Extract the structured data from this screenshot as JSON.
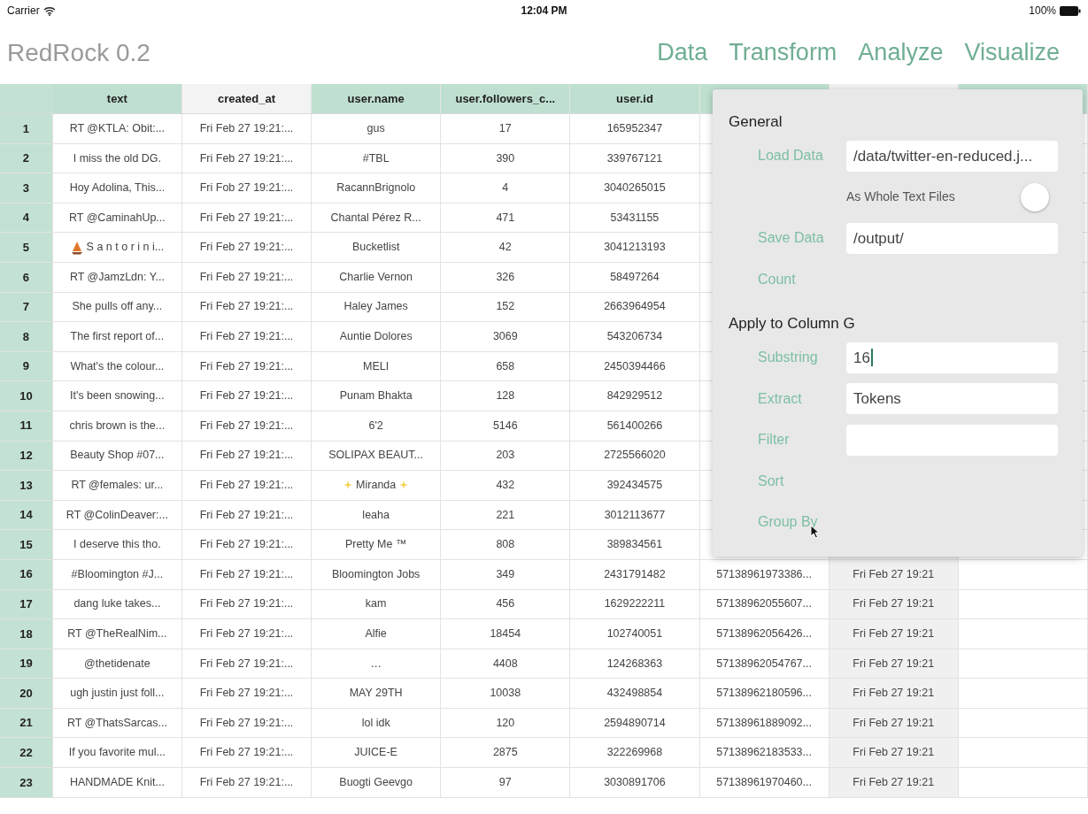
{
  "status_bar": {
    "carrier": "Carrier",
    "time": "12:04 PM",
    "battery": "100%"
  },
  "app_title": "RedRock 0.2",
  "nav": [
    {
      "label": "Data"
    },
    {
      "label": "Transform"
    },
    {
      "label": "Analyze"
    },
    {
      "label": "Visualize"
    }
  ],
  "table": {
    "columns": [
      {
        "label": "text",
        "selected": false
      },
      {
        "label": "created_at",
        "selected": true
      },
      {
        "label": "user.name",
        "selected": false
      },
      {
        "label": "user.followers_c...",
        "selected": false
      },
      {
        "label": "user.id",
        "selected": false
      },
      {
        "selected": false
      },
      {
        "selected": true,
        "shaded": true
      },
      {
        "selected": false
      }
    ],
    "rows": [
      {
        "index": "1",
        "cells": [
          "RT @KTLA: Obit:...",
          "Fri Feb 27 19:21:...",
          "gus",
          "17",
          "165952347"
        ]
      },
      {
        "index": "2",
        "cells": [
          "I miss the old DG.",
          "Fri Feb 27 19:21:...",
          "#TBL",
          "390",
          "339767121"
        ]
      },
      {
        "index": "3",
        "cells": [
          "Hoy Adolina, This...",
          "Fri Fob 27 19:21:...",
          "RacannBrignolo",
          "4",
          "3040265015"
        ]
      },
      {
        "index": "4",
        "cells": [
          "RT @CaminahUp...",
          "Fri Feb 27 19:21:...",
          "Chantal Pérez R...",
          "471",
          "53431155"
        ]
      },
      {
        "index": "5",
        "boat_icon": true,
        "cells": [
          "S a n t o r i n i...",
          "Fri Feb 27 19:21:...",
          "Bucketlist",
          "42",
          "3041213193"
        ]
      },
      {
        "index": "6",
        "cells": [
          "RT @JamzLdn: Y...",
          "Fri Feb 27 19:21:...",
          "Charlie Vernon",
          "326",
          "58497264"
        ]
      },
      {
        "index": "7",
        "cells": [
          "She pulls off any...",
          "Fri Feb 27 19:21:...",
          "Haley James",
          "152",
          "2663964954"
        ]
      },
      {
        "index": "8",
        "cells": [
          "The first report of...",
          "Fri Feb 27 19:21:...",
          "Auntie Dolores",
          "3069",
          "543206734"
        ]
      },
      {
        "index": "9",
        "cells": [
          "What's the colour...",
          "Fri Feb 27 19:21:...",
          "MELI",
          "658",
          "2450394466"
        ]
      },
      {
        "index": "10",
        "cells": [
          "It's been snowing...",
          "Fri Feb 27 19:21:...",
          "Punam Bhakta",
          "128",
          "842929512"
        ]
      },
      {
        "index": "11",
        "cells": [
          "chris brown is the...",
          "Fri Feb 27 19:21:...",
          "6'2",
          "5146",
          "561400266"
        ]
      },
      {
        "index": "12",
        "cells": [
          "Beauty Shop #07...",
          "Fri Feb 27 19:21:...",
          "SOLIPAX BEAUT...",
          "203",
          "2725566020"
        ]
      },
      {
        "index": "13",
        "name_sparkles": true,
        "cells": [
          "RT @females: ur...",
          "Fri Feb 27 19:21:...",
          "Miranda",
          "432",
          "392434575"
        ]
      },
      {
        "index": "14",
        "cells": [
          "RT @ColinDeaver:...",
          "Fri Feb 27 19:21:...",
          "leaha",
          "221",
          "3012113677"
        ]
      },
      {
        "index": "15",
        "cells": [
          "I deserve this tho.",
          "Fri Feb 27 19:21:...",
          "Pretty Me ™",
          "808",
          "389834561"
        ]
      },
      {
        "index": "16",
        "cells": [
          "#Bloomington #J...",
          "Fri Feb 27 19:21:...",
          "Bloomington Jobs",
          "349",
          "2431791482",
          "57138961973386...",
          "Fri Feb 27 19:21"
        ]
      },
      {
        "index": "17",
        "cells": [
          "dang luke takes...",
          "Fri Feb 27 19:21:...",
          "kam",
          "456",
          "1629222211",
          "57138962055607...",
          "Fri Feb 27 19:21"
        ]
      },
      {
        "index": "18",
        "cells": [
          "RT @TheRealNim...",
          "Fri Feb 27 19:21:...",
          "Alfie",
          "18454",
          "102740051",
          "57138962056426...",
          "Fri Feb 27 19:21"
        ]
      },
      {
        "index": "19",
        "cells": [
          "@thetidenate",
          "Fri Feb 27 19:21:...",
          "…",
          "4408",
          "124268363",
          "57138962054767...",
          "Fri Feb 27 19:21"
        ]
      },
      {
        "index": "20",
        "cells": [
          "ugh justin just foll...",
          "Fri Feb 27 19:21:...",
          "MAY 29TH",
          "10038",
          "432498854",
          "57138962180596...",
          "Fri Feb 27 19:21"
        ]
      },
      {
        "index": "21",
        "cells": [
          "RT @ThatsSarcas...",
          "Fri Feb 27 19:21:...",
          "lol idk",
          "120",
          "2594890714",
          "57138961889092...",
          "Fri Feb 27 19:21"
        ]
      },
      {
        "index": "22",
        "cells": [
          "If you favorite mul...",
          "Fri Feb 27 19:21:...",
          "JUICE-E",
          "2875",
          "322269968",
          "57138962183533...",
          "Fri Feb 27 19:21"
        ]
      },
      {
        "index": "23",
        "cells": [
          "HANDMADE Knit...",
          "Fri Feb 27 19:21:...",
          "Buogti Geevgo",
          "97",
          "3030891706",
          "57138961970460...",
          "Fri Feb 27 19:21"
        ]
      }
    ]
  },
  "panel": {
    "sections": [
      {
        "heading": "General",
        "items": [
          {
            "kind": "field",
            "label": "Load Data",
            "value": "/data/twitter-en-reduced.j..."
          },
          {
            "kind": "toggle",
            "label": "As Whole Text Files",
            "on": false
          },
          {
            "kind": "field",
            "label": "Save Data",
            "value": "/output/"
          },
          {
            "kind": "action",
            "label": "Count"
          }
        ]
      },
      {
        "heading": "Apply to Column G",
        "items": [
          {
            "kind": "field",
            "label": "Substring",
            "value": "16",
            "focused": true
          },
          {
            "kind": "field",
            "label": "Extract",
            "value": "Tokens"
          },
          {
            "kind": "field",
            "label": "Filter"
          },
          {
            "kind": "action",
            "label": "Sort"
          },
          {
            "kind": "action",
            "label": "Group By"
          }
        ]
      }
    ]
  }
}
